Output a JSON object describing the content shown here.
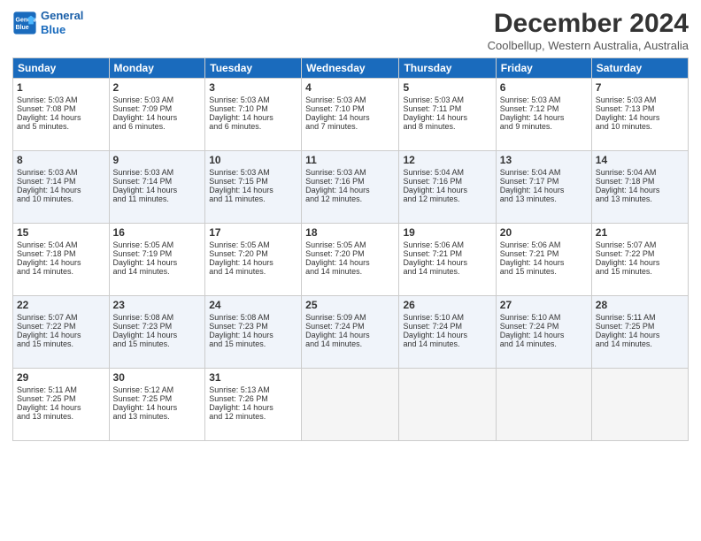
{
  "logo": {
    "line1": "General",
    "line2": "Blue"
  },
  "title": "December 2024",
  "subtitle": "Coolbellup, Western Australia, Australia",
  "days_of_week": [
    "Sunday",
    "Monday",
    "Tuesday",
    "Wednesday",
    "Thursday",
    "Friday",
    "Saturday"
  ],
  "weeks": [
    [
      {
        "day": 1,
        "lines": [
          "Sunrise: 5:03 AM",
          "Sunset: 7:08 PM",
          "Daylight: 14 hours",
          "and 5 minutes."
        ]
      },
      {
        "day": 2,
        "lines": [
          "Sunrise: 5:03 AM",
          "Sunset: 7:09 PM",
          "Daylight: 14 hours",
          "and 6 minutes."
        ]
      },
      {
        "day": 3,
        "lines": [
          "Sunrise: 5:03 AM",
          "Sunset: 7:10 PM",
          "Daylight: 14 hours",
          "and 6 minutes."
        ]
      },
      {
        "day": 4,
        "lines": [
          "Sunrise: 5:03 AM",
          "Sunset: 7:10 PM",
          "Daylight: 14 hours",
          "and 7 minutes."
        ]
      },
      {
        "day": 5,
        "lines": [
          "Sunrise: 5:03 AM",
          "Sunset: 7:11 PM",
          "Daylight: 14 hours",
          "and 8 minutes."
        ]
      },
      {
        "day": 6,
        "lines": [
          "Sunrise: 5:03 AM",
          "Sunset: 7:12 PM",
          "Daylight: 14 hours",
          "and 9 minutes."
        ]
      },
      {
        "day": 7,
        "lines": [
          "Sunrise: 5:03 AM",
          "Sunset: 7:13 PM",
          "Daylight: 14 hours",
          "and 10 minutes."
        ]
      }
    ],
    [
      {
        "day": 8,
        "lines": [
          "Sunrise: 5:03 AM",
          "Sunset: 7:14 PM",
          "Daylight: 14 hours",
          "and 10 minutes."
        ]
      },
      {
        "day": 9,
        "lines": [
          "Sunrise: 5:03 AM",
          "Sunset: 7:14 PM",
          "Daylight: 14 hours",
          "and 11 minutes."
        ]
      },
      {
        "day": 10,
        "lines": [
          "Sunrise: 5:03 AM",
          "Sunset: 7:15 PM",
          "Daylight: 14 hours",
          "and 11 minutes."
        ]
      },
      {
        "day": 11,
        "lines": [
          "Sunrise: 5:03 AM",
          "Sunset: 7:16 PM",
          "Daylight: 14 hours",
          "and 12 minutes."
        ]
      },
      {
        "day": 12,
        "lines": [
          "Sunrise: 5:04 AM",
          "Sunset: 7:16 PM",
          "Daylight: 14 hours",
          "and 12 minutes."
        ]
      },
      {
        "day": 13,
        "lines": [
          "Sunrise: 5:04 AM",
          "Sunset: 7:17 PM",
          "Daylight: 14 hours",
          "and 13 minutes."
        ]
      },
      {
        "day": 14,
        "lines": [
          "Sunrise: 5:04 AM",
          "Sunset: 7:18 PM",
          "Daylight: 14 hours",
          "and 13 minutes."
        ]
      }
    ],
    [
      {
        "day": 15,
        "lines": [
          "Sunrise: 5:04 AM",
          "Sunset: 7:18 PM",
          "Daylight: 14 hours",
          "and 14 minutes."
        ]
      },
      {
        "day": 16,
        "lines": [
          "Sunrise: 5:05 AM",
          "Sunset: 7:19 PM",
          "Daylight: 14 hours",
          "and 14 minutes."
        ]
      },
      {
        "day": 17,
        "lines": [
          "Sunrise: 5:05 AM",
          "Sunset: 7:20 PM",
          "Daylight: 14 hours",
          "and 14 minutes."
        ]
      },
      {
        "day": 18,
        "lines": [
          "Sunrise: 5:05 AM",
          "Sunset: 7:20 PM",
          "Daylight: 14 hours",
          "and 14 minutes."
        ]
      },
      {
        "day": 19,
        "lines": [
          "Sunrise: 5:06 AM",
          "Sunset: 7:21 PM",
          "Daylight: 14 hours",
          "and 14 minutes."
        ]
      },
      {
        "day": 20,
        "lines": [
          "Sunrise: 5:06 AM",
          "Sunset: 7:21 PM",
          "Daylight: 14 hours",
          "and 15 minutes."
        ]
      },
      {
        "day": 21,
        "lines": [
          "Sunrise: 5:07 AM",
          "Sunset: 7:22 PM",
          "Daylight: 14 hours",
          "and 15 minutes."
        ]
      }
    ],
    [
      {
        "day": 22,
        "lines": [
          "Sunrise: 5:07 AM",
          "Sunset: 7:22 PM",
          "Daylight: 14 hours",
          "and 15 minutes."
        ]
      },
      {
        "day": 23,
        "lines": [
          "Sunrise: 5:08 AM",
          "Sunset: 7:23 PM",
          "Daylight: 14 hours",
          "and 15 minutes."
        ]
      },
      {
        "day": 24,
        "lines": [
          "Sunrise: 5:08 AM",
          "Sunset: 7:23 PM",
          "Daylight: 14 hours",
          "and 15 minutes."
        ]
      },
      {
        "day": 25,
        "lines": [
          "Sunrise: 5:09 AM",
          "Sunset: 7:24 PM",
          "Daylight: 14 hours",
          "and 14 minutes."
        ]
      },
      {
        "day": 26,
        "lines": [
          "Sunrise: 5:10 AM",
          "Sunset: 7:24 PM",
          "Daylight: 14 hours",
          "and 14 minutes."
        ]
      },
      {
        "day": 27,
        "lines": [
          "Sunrise: 5:10 AM",
          "Sunset: 7:24 PM",
          "Daylight: 14 hours",
          "and 14 minutes."
        ]
      },
      {
        "day": 28,
        "lines": [
          "Sunrise: 5:11 AM",
          "Sunset: 7:25 PM",
          "Daylight: 14 hours",
          "and 14 minutes."
        ]
      }
    ],
    [
      {
        "day": 29,
        "lines": [
          "Sunrise: 5:11 AM",
          "Sunset: 7:25 PM",
          "Daylight: 14 hours",
          "and 13 minutes."
        ]
      },
      {
        "day": 30,
        "lines": [
          "Sunrise: 5:12 AM",
          "Sunset: 7:25 PM",
          "Daylight: 14 hours",
          "and 13 minutes."
        ]
      },
      {
        "day": 31,
        "lines": [
          "Sunrise: 5:13 AM",
          "Sunset: 7:26 PM",
          "Daylight: 14 hours",
          "and 12 minutes."
        ]
      },
      null,
      null,
      null,
      null
    ]
  ]
}
